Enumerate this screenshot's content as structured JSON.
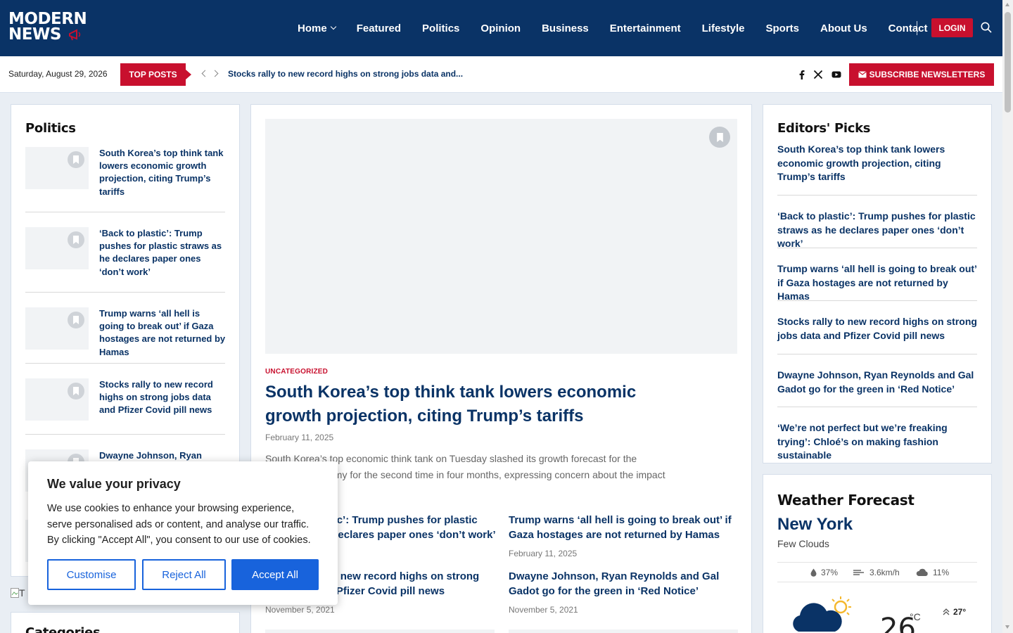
{
  "site": {
    "logo_line1": "MODERN",
    "logo_line2": "NEWS"
  },
  "nav": {
    "items": [
      "Home",
      "Featured",
      "Politics",
      "Opinion",
      "Business",
      "Entertainment",
      "Lifestyle",
      "Sports",
      "About Us",
      "Contact"
    ],
    "login_label": "LOGIN"
  },
  "topbar": {
    "date": "Saturday, August 29, 2026",
    "top_posts_label": "TOP POSTS",
    "ticker_text": "Stocks rally to new record highs on strong jobs data and...",
    "subscribe_label": "SUBSCRIBE NEWSLETTERS"
  },
  "politics": {
    "title": "Politics",
    "items": [
      "South Korea’s top think tank lowers economic growth projection, citing Trump’s tariffs",
      "‘Back to plastic’: Trump pushes for plastic straws as he declares paper ones ‘don’t work’",
      "Trump warns ‘all hell is going to break out’ if Gaza hostages are not returned by Hamas",
      "Stocks rally to new record highs on strong jobs data and Pfizer Covid pill news",
      "Dwayne Johnson, Ryan"
    ]
  },
  "main": {
    "category": "UNCATEGORIZED",
    "title": "South Korea’s top think tank lowers economic growth projection, citing Trump’s tariffs",
    "date": "February 11, 2025",
    "excerpt": "South Korea’s top economic think tank on Tuesday slashed its growth forecast for the country’s economy for the second time in four months, expressing concern about the impact ...",
    "grid": [
      {
        "title": "‘Back to plastic’: Trump pushes for plastic straws as he declares paper ones ‘don’t work’",
        "date": "February 11, 2025"
      },
      {
        "title": "Trump warns ‘all hell is going to break out’ if Gaza hostages are not returned by Hamas",
        "date": "February 11, 2025"
      },
      {
        "title": "Stocks rally to new record highs on strong jobs data and Pfizer Covid pill news",
        "date": "November 5, 2021"
      },
      {
        "title": "Dwayne Johnson, Ryan Reynolds and Gal Gadot go for the green in ‘Red Notice’",
        "date": "November 5, 2021"
      }
    ]
  },
  "editors_picks": {
    "title": "Editors' Picks",
    "items": [
      "South Korea’s top think tank lowers economic growth projection, citing Trump’s tariffs",
      "‘Back to plastic’: Trump pushes for plastic straws as he declares paper ones ‘don’t work’",
      "Trump warns ‘all hell is going to break out’ if Gaza hostages are not returned by Hamas",
      "Stocks rally to new record highs on strong jobs data and Pfizer Covid pill news",
      "Dwayne Johnson, Ryan Reynolds and Gal Gadot go for the green in ‘Red Notice’",
      "‘We’re not perfect but we’re freaking trying’: Chloé’s on making fashion sustainable"
    ]
  },
  "weather": {
    "title": "Weather Forecast",
    "city": "New York",
    "description": "Few Clouds",
    "humidity": "37%",
    "wind": "3.6km/h",
    "clouds": "11%",
    "temp": "26",
    "unit": "°C",
    "high": "27°"
  },
  "categories": {
    "title": "Categories",
    "broken_image_alt": "T"
  },
  "cookie": {
    "title": "We value your privacy",
    "text": "We use cookies to enhance your browsing experience, serve personalised ads or content, and analyse our traffic. By clicking \"Accept All\", you consent to our use of cookies.",
    "customise": "Customise",
    "reject": "Reject All",
    "accept": "Accept All"
  },
  "colors": {
    "brand_navy": "#0a3366",
    "accent_red": "#c8102e",
    "cookie_blue": "#1863dc"
  }
}
